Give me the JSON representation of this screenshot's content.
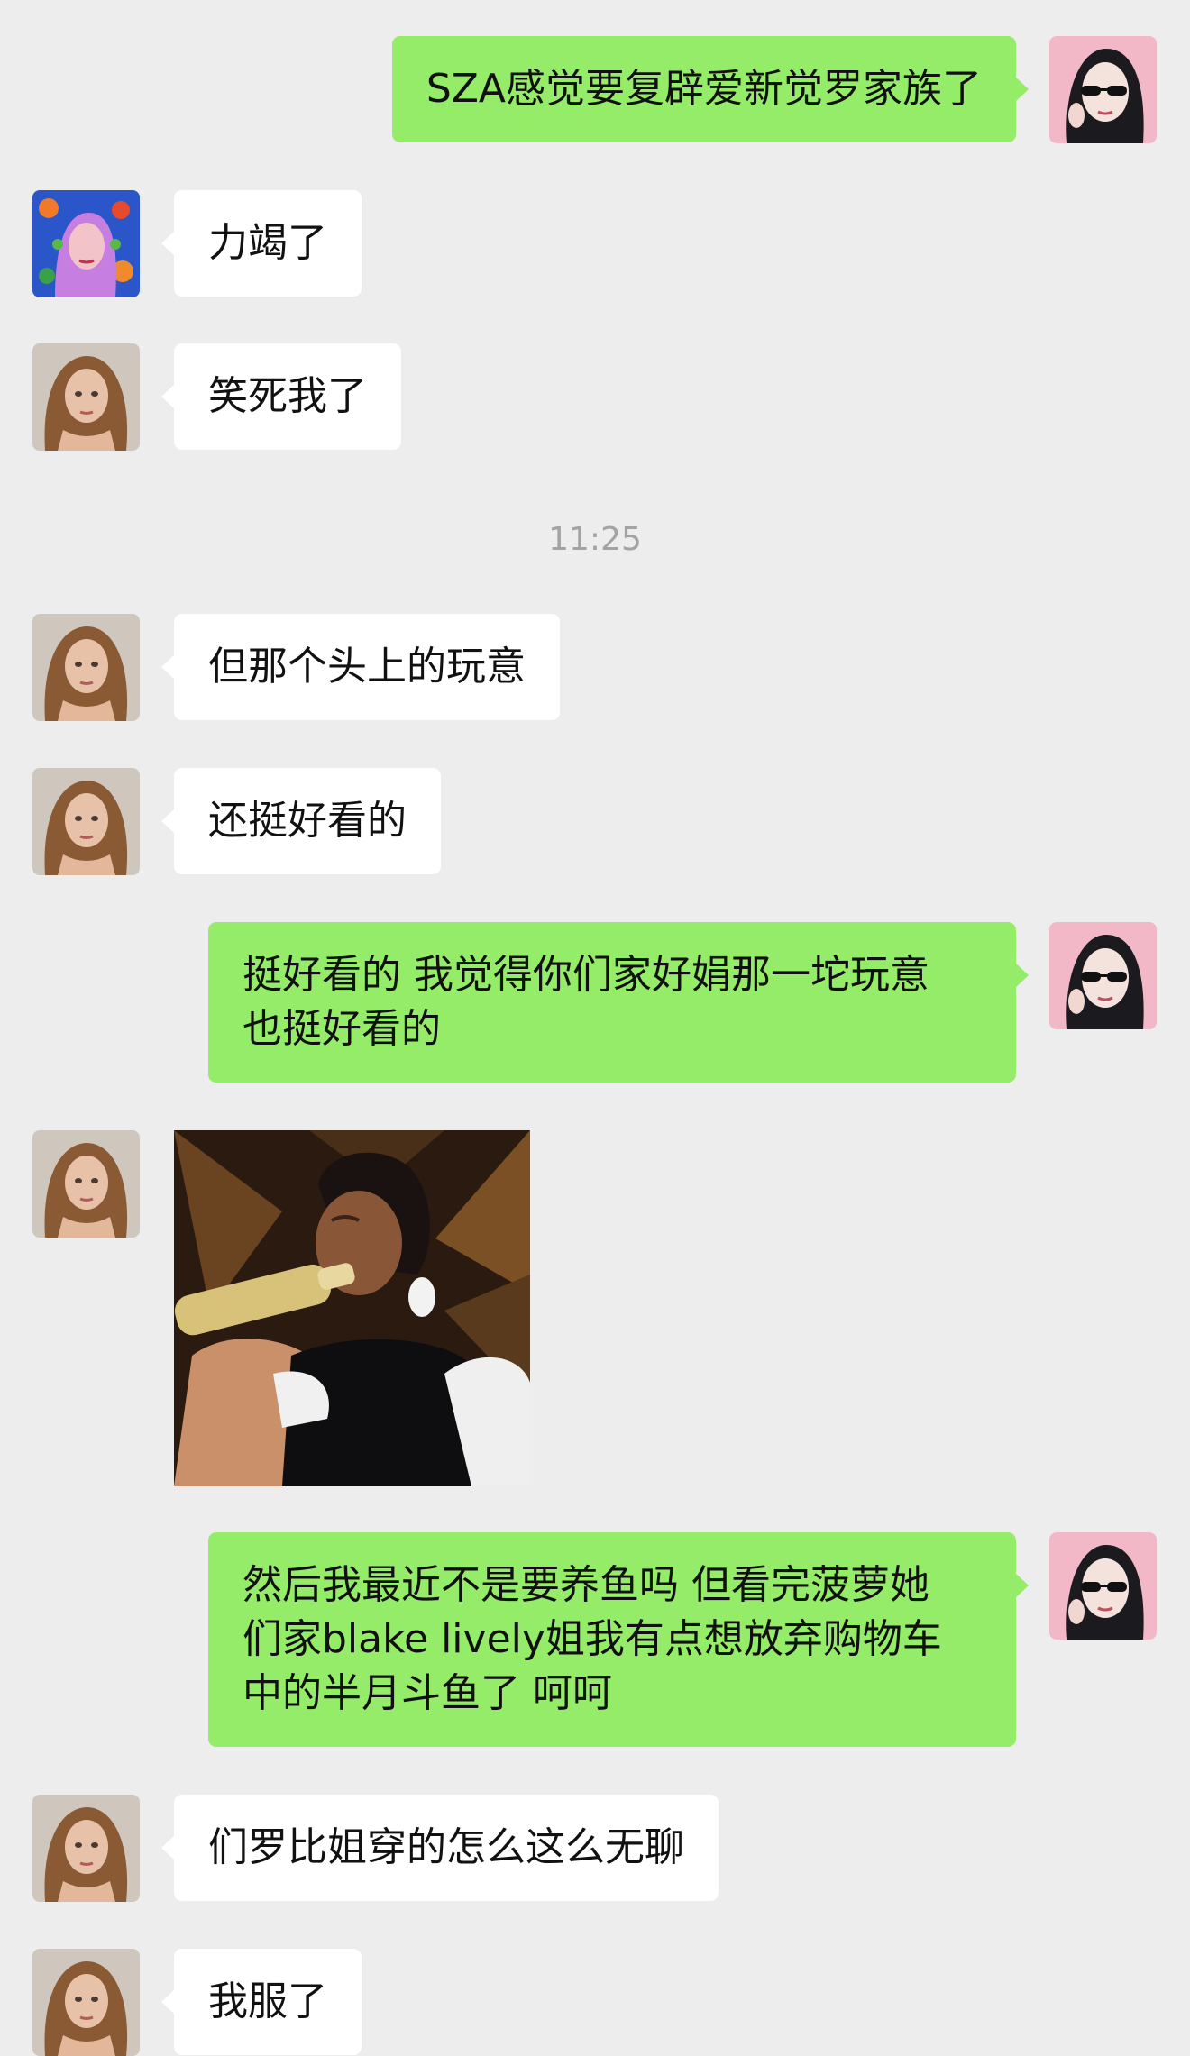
{
  "chat": {
    "timestamp": "11:25",
    "messages": [
      {
        "sender": "me",
        "text": "SZA感觉要复辟爱新觉罗家族了"
      },
      {
        "sender": "friend-floral",
        "text": "力竭了"
      },
      {
        "sender": "friend-blonde",
        "text": "笑死我了"
      },
      {
        "sender": "friend-blonde",
        "text": "但那个头上的玩意"
      },
      {
        "sender": "friend-blonde",
        "text": "还挺好看的"
      },
      {
        "sender": "me",
        "text": "挺好看的 我觉得你们家好娟那一坨玩意\n也挺好看的"
      },
      {
        "sender": "friend-blonde",
        "type": "image",
        "text": ""
      },
      {
        "sender": "me",
        "text": "然后我最近不是要养鱼吗 但看完菠萝她\n们家blake lively姐我有点想放弃购物车\n中的半月斗鱼了 呵呵"
      },
      {
        "sender": "friend-blonde",
        "text": "们罗比姐穿的怎么这么无聊"
      },
      {
        "sender": "friend-blonde",
        "text": "我服了"
      }
    ]
  },
  "colors": {
    "background": "#ededed",
    "outgoing_bubble": "#95ec69",
    "incoming_bubble": "#ffffff",
    "timestamp_text": "#a3a3a3"
  },
  "icons": {
    "me_avatar": "avatar-girl-sunglasses",
    "friend_floral_avatar": "avatar-floral-illustration",
    "friend_blonde_avatar": "avatar-blonde-woman"
  }
}
